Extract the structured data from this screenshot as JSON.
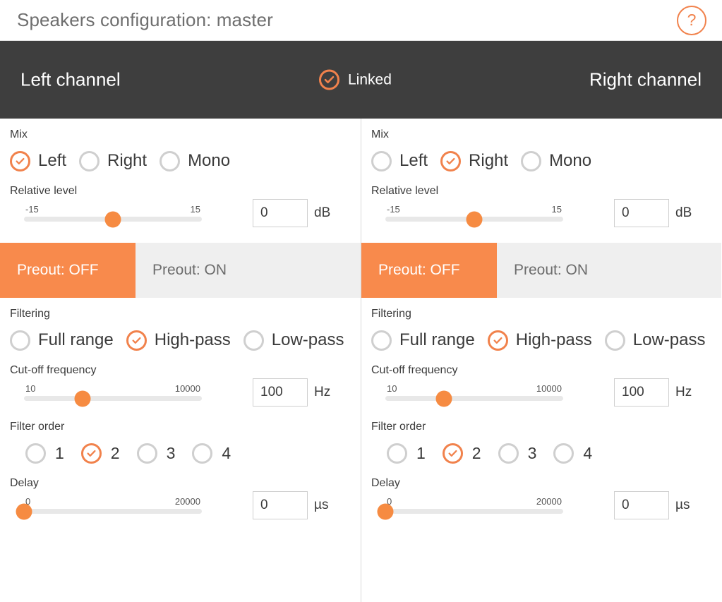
{
  "header": {
    "title": "Speakers configuration: master",
    "help_icon": "question-mark-icon",
    "help_label": "?"
  },
  "channel_bar": {
    "left_label": "Left channel",
    "right_label": "Right channel",
    "linked_label": "Linked",
    "linked_checked": true,
    "linked_icon": "check-circle-icon"
  },
  "colors": {
    "accent": "#f88a4c",
    "accent_border": "#f1824c",
    "dark_bar": "#3e3e3e",
    "track": "#e8e8e8",
    "tab_bg": "#efefef",
    "title_text": "#6f6f6f"
  },
  "panels": [
    {
      "name": "left-channel",
      "mix": {
        "label": "Mix",
        "options": [
          "Left",
          "Right",
          "Mono"
        ],
        "selected": "Left"
      },
      "relative_level": {
        "label": "Relative level",
        "min": "-15",
        "max": "15",
        "value": "0",
        "unit": "dB",
        "thumb_percent": 50
      },
      "preout": {
        "off_label": "Preout: OFF",
        "on_label": "Preout: ON",
        "selected": "Preout: OFF"
      },
      "filtering": {
        "label": "Filtering",
        "options": [
          "Full range",
          "High-pass",
          "Low-pass"
        ],
        "selected": "High-pass"
      },
      "cutoff": {
        "label": "Cut-off frequency",
        "min": "10",
        "max": "10000",
        "value": "100",
        "unit": "Hz",
        "thumb_percent": 33
      },
      "filter_order": {
        "label": "Filter order",
        "options": [
          "1",
          "2",
          "3",
          "4"
        ],
        "selected": "2"
      },
      "delay": {
        "label": "Delay",
        "min": "0",
        "max": "20000",
        "value": "0",
        "unit": "µs",
        "thumb_percent": 0
      }
    },
    {
      "name": "right-channel",
      "mix": {
        "label": "Mix",
        "options": [
          "Left",
          "Right",
          "Mono"
        ],
        "selected": "Right"
      },
      "relative_level": {
        "label": "Relative level",
        "min": "-15",
        "max": "15",
        "value": "0",
        "unit": "dB",
        "thumb_percent": 50
      },
      "preout": {
        "off_label": "Preout: OFF",
        "on_label": "Preout: ON",
        "selected": "Preout: OFF"
      },
      "filtering": {
        "label": "Filtering",
        "options": [
          "Full range",
          "High-pass",
          "Low-pass"
        ],
        "selected": "High-pass"
      },
      "cutoff": {
        "label": "Cut-off frequency",
        "min": "10",
        "max": "10000",
        "value": "100",
        "unit": "Hz",
        "thumb_percent": 33
      },
      "filter_order": {
        "label": "Filter order",
        "options": [
          "1",
          "2",
          "3",
          "4"
        ],
        "selected": "2"
      },
      "delay": {
        "label": "Delay",
        "min": "0",
        "max": "20000",
        "value": "0",
        "unit": "µs",
        "thumb_percent": 0
      }
    }
  ]
}
